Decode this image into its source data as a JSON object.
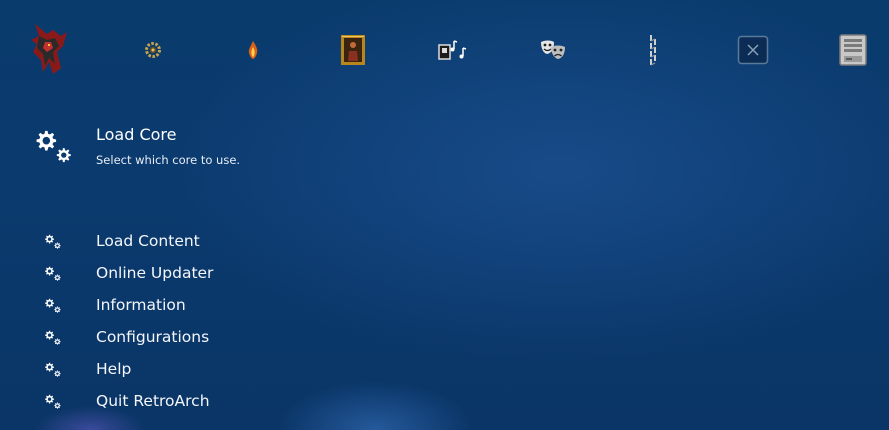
{
  "tabs": [
    {
      "icon": "retroarch-main-menu-icon"
    },
    {
      "icon": "settings-gear-icon"
    },
    {
      "icon": "favorites-flame-icon"
    },
    {
      "icon": "images-frame-icon"
    },
    {
      "icon": "music-notes-icon"
    },
    {
      "icon": "video-masks-icon"
    },
    {
      "icon": "netplay-chain-icon"
    },
    {
      "icon": "add-content-icon"
    },
    {
      "icon": "snes-system-icon"
    }
  ],
  "selected": {
    "title": "Load Core",
    "subtitle": "Select which core to use.",
    "icon": "gears-icon"
  },
  "menu": {
    "items": [
      {
        "label": "Load Content",
        "icon": "gears-icon"
      },
      {
        "label": "Online Updater",
        "icon": "gears-icon"
      },
      {
        "label": "Information",
        "icon": "gears-icon"
      },
      {
        "label": "Configurations",
        "icon": "gears-icon"
      },
      {
        "label": "Help",
        "icon": "gears-icon"
      },
      {
        "label": "Quit RetroArch",
        "icon": "gears-icon"
      }
    ]
  },
  "colors": {
    "background": "#0b3a6e",
    "text": "#ffffff"
  }
}
